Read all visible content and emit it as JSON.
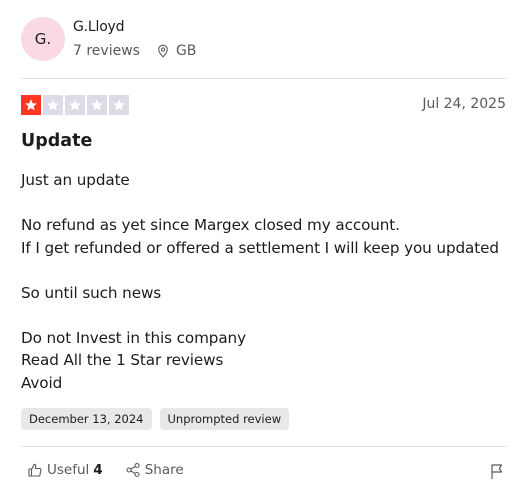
{
  "reviewer": {
    "initials": "G.",
    "name": "G.Lloyd",
    "reviews": "7 reviews",
    "country": "GB"
  },
  "rating": {
    "stars": 1,
    "max": 5
  },
  "review": {
    "date": "Jul 24, 2025",
    "title": "Update",
    "body": "Just an update\n\nNo refund as yet since Margex closed my account.\nIf I get refunded or offered a settlement I will keep you updated\n\nSo until such news\n\nDo not Invest in this company\nRead All the 1 Star reviews\nAvoid"
  },
  "tags": {
    "experience_date": "December 13, 2024",
    "review_type": "Unprompted review"
  },
  "actions": {
    "useful_label": "Useful",
    "useful_count": "4",
    "share_label": "Share"
  },
  "colors": {
    "star_filled": "#ff3722",
    "star_empty": "#dcdce6",
    "avatar_bg": "#fbd9e4"
  },
  "icons": [
    "location-pin-icon",
    "star-icon",
    "thumbs-up-icon",
    "share-icon",
    "flag-icon"
  ]
}
